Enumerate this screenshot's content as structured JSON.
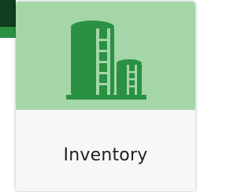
{
  "tile": {
    "label": "Inventory",
    "icon": "storage-tanks-icon"
  },
  "colors": {
    "tile_top": "#a5d6a8",
    "icon": "#2a9142",
    "tile_bottom": "#f7f7f7",
    "dark_bar": "#0f3d1d",
    "green_strip": "#2a9142",
    "label_text": "#1f1f1f"
  }
}
